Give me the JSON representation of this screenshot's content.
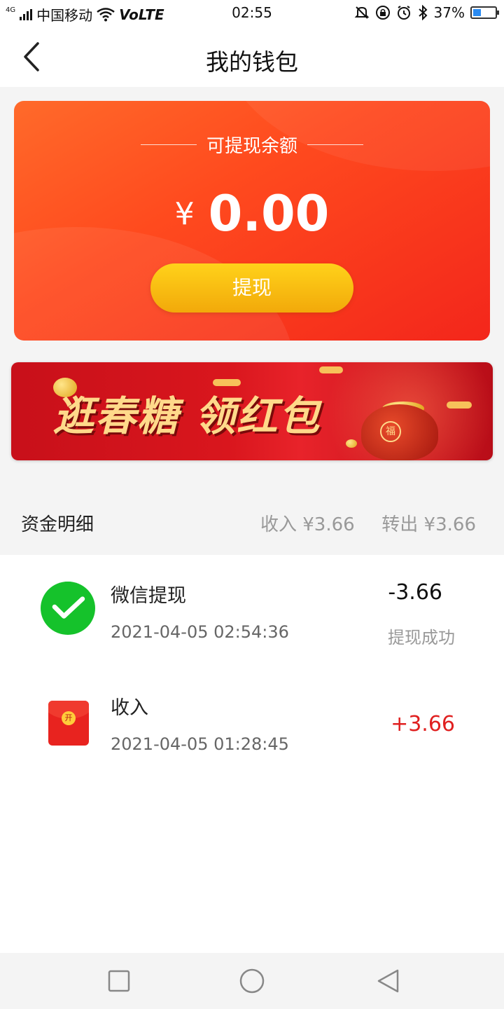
{
  "status_bar": {
    "network": "4G",
    "carrier": "中国移动",
    "volte": "VoLTE",
    "time": "02:55",
    "battery_percent": "37%",
    "battery_level": 0.37,
    "icons": [
      "signal-icon",
      "wifi-icon",
      "mute-icon",
      "rotation-lock-icon",
      "alarm-icon",
      "bluetooth-icon",
      "battery-icon"
    ]
  },
  "header": {
    "title": "我的钱包",
    "back_icon": "chevron-left-icon"
  },
  "balance_card": {
    "label": "可提现余额",
    "currency": "¥",
    "amount": "0.00",
    "withdraw_label": "提现"
  },
  "promo_banner": {
    "text": "逛春糖 领红包"
  },
  "transactions": {
    "title": "资金明细",
    "income_summary": "收入 ¥3.66",
    "outgoing_summary": "转出 ¥3.66",
    "items": [
      {
        "icon": "wechat-icon",
        "name": "微信提现",
        "time": "2021-04-05 02:54:36",
        "amount": "-3.66",
        "status": "提现成功",
        "amount_color": "#111111"
      },
      {
        "icon": "red-packet-icon",
        "name": "收入",
        "time": "2021-04-05 01:28:45",
        "amount": "+3.66",
        "icon_text": "开",
        "amount_color": "#e02020"
      }
    ]
  },
  "system_nav": {
    "icons": [
      "recents-square-icon",
      "home-circle-icon",
      "back-triangle-icon"
    ]
  }
}
